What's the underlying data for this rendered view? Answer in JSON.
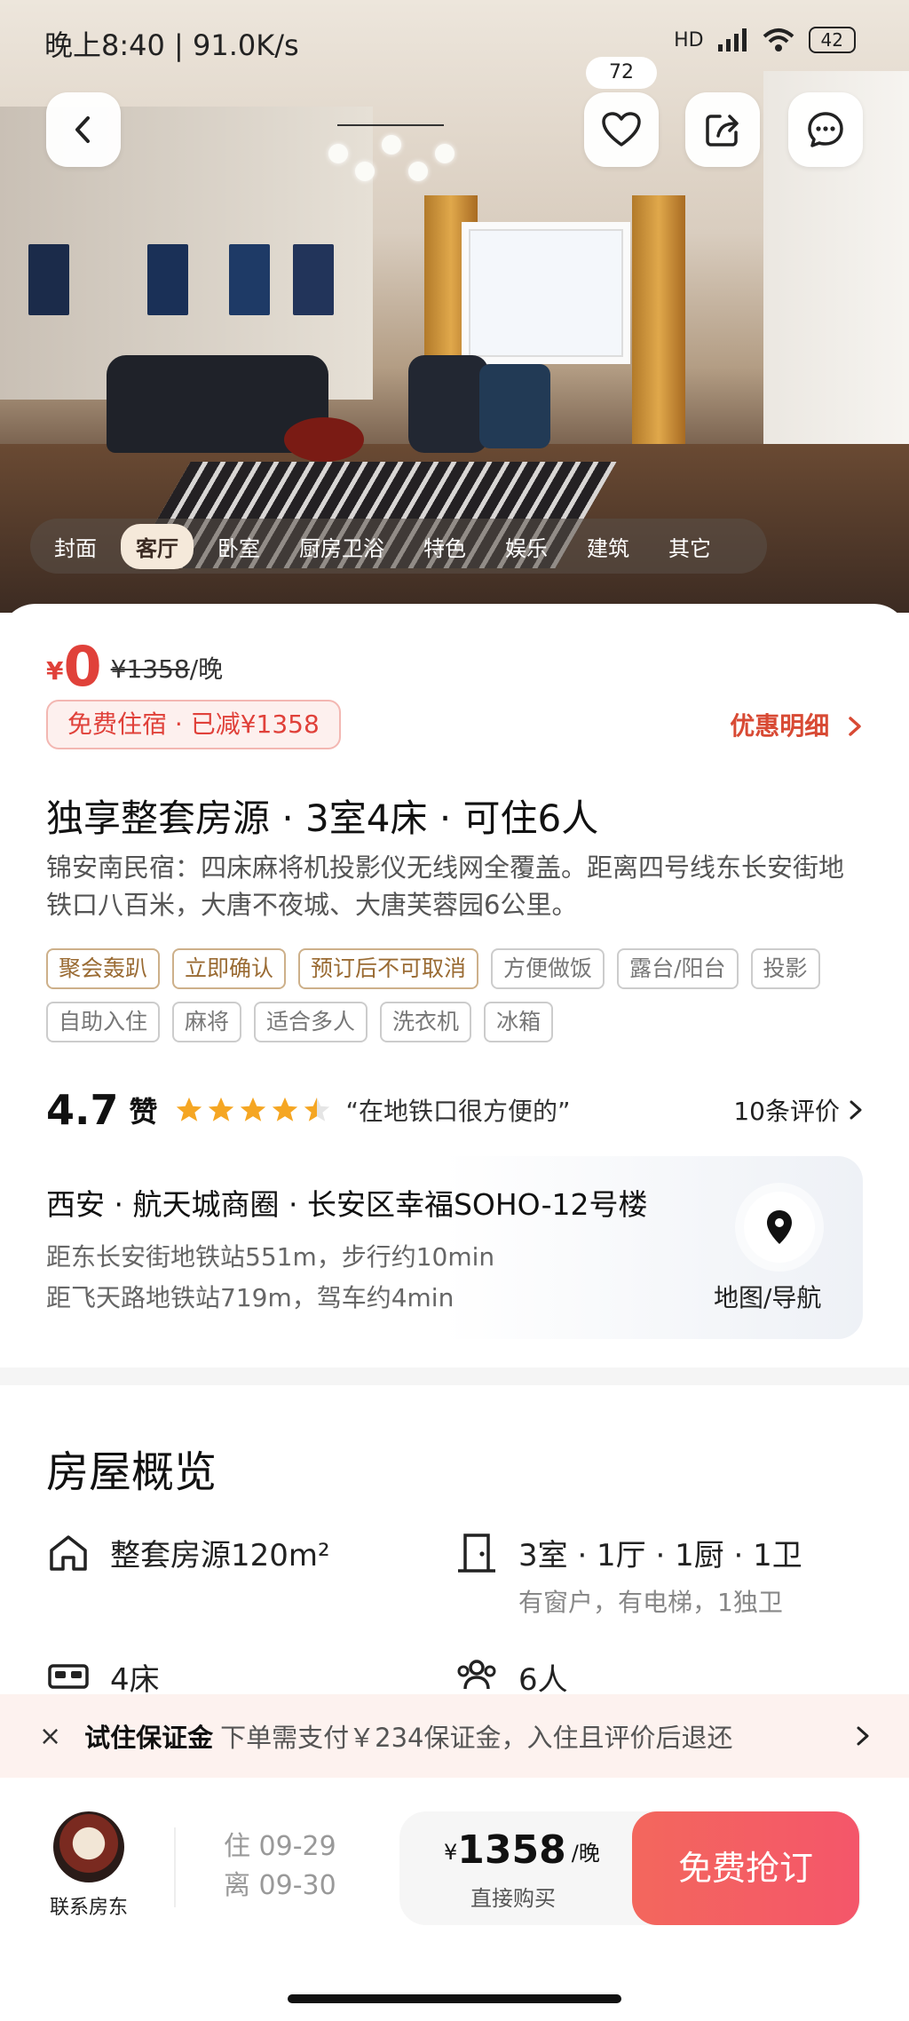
{
  "status": {
    "time_speed": "晚上8:40 | 91.0K/s",
    "battery": "42",
    "network": "HD"
  },
  "header": {
    "favorite_count": "72"
  },
  "gallery_tabs": [
    {
      "label": "封面",
      "active": false
    },
    {
      "label": "客厅",
      "active": true
    },
    {
      "label": "卧室",
      "active": false
    },
    {
      "label": "厨房卫浴",
      "active": false
    },
    {
      "label": "特色",
      "active": false
    },
    {
      "label": "娱乐",
      "active": false
    },
    {
      "label": "建筑",
      "active": false
    },
    {
      "label": "其它",
      "active": false
    }
  ],
  "price": {
    "currency": "¥",
    "current": "0",
    "original": "¥1358",
    "unit": "/晚",
    "badge": "免费住宿 · 已减¥1358",
    "discount_link": "优惠明细"
  },
  "listing": {
    "title": "独享整套房源 · 3室4床 · 可住6人",
    "description": "锦安南民宿：四床麻将机投影仪无线网全覆盖。距离四号线东长安街地铁口八百米，大唐不夜城、大唐芙蓉园6公里。",
    "tags_highlight": [
      "聚会轰趴",
      "立即确认",
      "预订后不可取消"
    ],
    "tags": [
      "方便做饭",
      "露台/阳台",
      "投影",
      "自助入住",
      "麻将",
      "适合多人",
      "洗衣机",
      "冰箱"
    ]
  },
  "rating": {
    "score": "4.7",
    "label": "赞",
    "stars": 4.5,
    "quote": "“在地铁口很方便的”",
    "reviews": "10条评价"
  },
  "location": {
    "address": "西安 · 航天城商圈 · 长安区幸福SOHO-12号楼",
    "line1": "距东长安街地铁站551m，步行约10min",
    "line2": "距飞天路地铁站719m，驾车约4min",
    "map_label": "地图/导航"
  },
  "overview": {
    "title": "房屋概览",
    "area": "整套房源120m²",
    "rooms": "3室 · 1厅 · 1厨 · 1卫",
    "rooms_sub": "有窗户，有电梯，1独卫",
    "beds": "4床",
    "guests": "6人"
  },
  "deposit": {
    "close": "×",
    "title": "试住保证金",
    "text": "下单需支付￥234保证金，入住且评价后退还"
  },
  "footer": {
    "host_label": "联系房东",
    "checkin": "住  09-29",
    "checkout": "离  09-30",
    "buy_currency": "¥",
    "buy_price": "1358",
    "buy_unit": "/晚",
    "buy_sub": "直接购买",
    "book_label": "免费抢订"
  },
  "colors": {
    "accent_red": "#e0413a",
    "book_button": "#f4566a",
    "tag_highlight": "#9a6b33",
    "star": "#f5a623"
  }
}
